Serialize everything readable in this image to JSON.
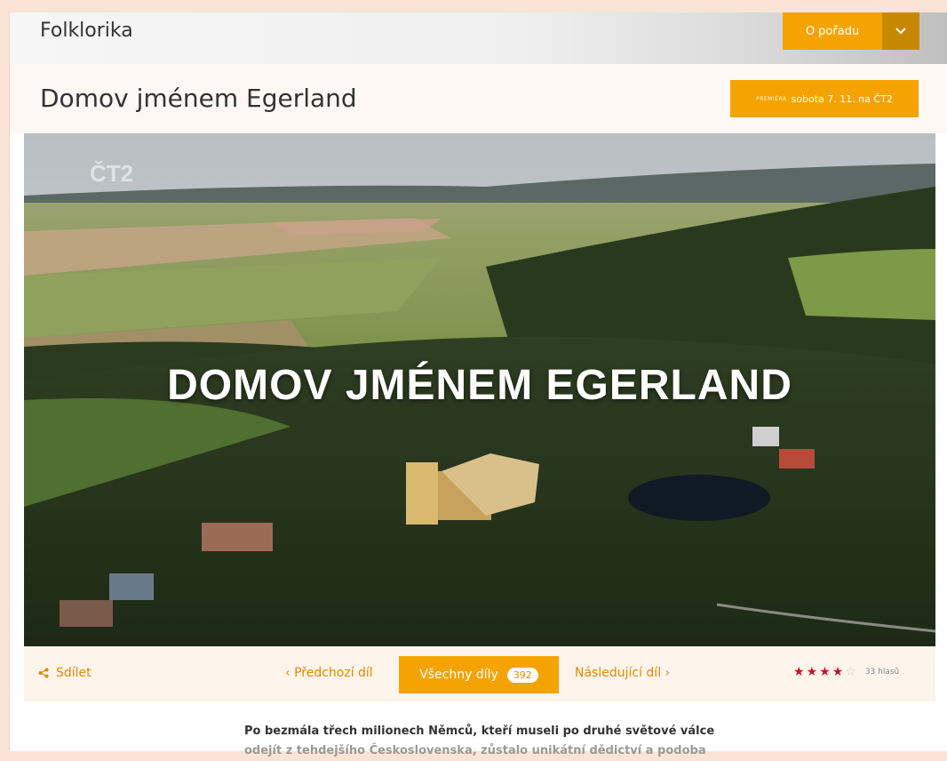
{
  "header": {
    "brand": "Folklorika",
    "about_button": "O pořadu"
  },
  "episode": {
    "title": "Domov jménem Egerland",
    "premiere_prefix": "PREMIÉRA",
    "premiere_date": "sobota 7. 11. na ČT2"
  },
  "video": {
    "channel_logo": "ČT2",
    "overlay_title": "DOMOV JMÉNEM EGERLAND"
  },
  "navigation": {
    "share": "Sdílet",
    "previous": "Předchozí díl",
    "all_episodes": "Všechny díly",
    "episode_count": "392",
    "next": "Následující díl",
    "rating": 4,
    "rating_max": 5,
    "votes": "33 hlasů"
  },
  "description": {
    "line1": "Po bezmála třech milionech Němců, kteří museli po druhé světové válce",
    "line2": "odejít z tehdejšího Československa, zůstalo unikátní dědictví a podoba"
  },
  "colors": {
    "accent": "#f5a300",
    "accent_dark": "#c78800",
    "star": "#c8102e"
  }
}
